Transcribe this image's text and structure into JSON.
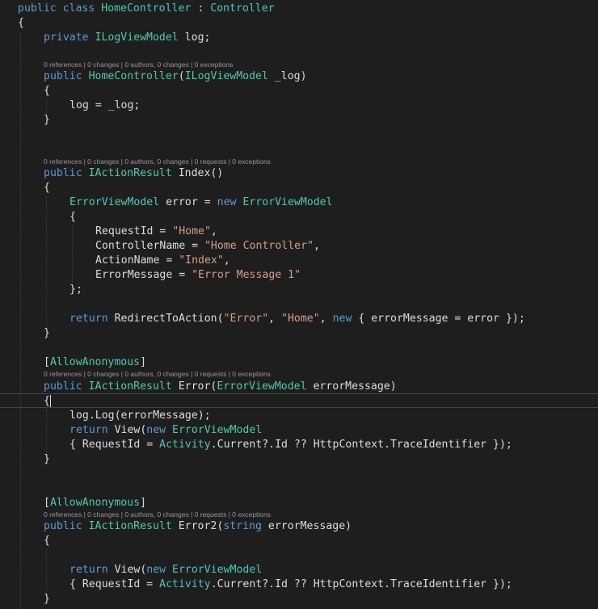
{
  "editor": {
    "codelens": {
      "constructor": "0 references | 0 changes | 0 authors, 0 changes | 0 exceptions",
      "index": "0 references | 0 changes | 0 authors, 0 changes | 0 requests | 0 exceptions",
      "error": "0 references | 0 changes | 0 authors, 0 changes | 0 requests | 0 exceptions",
      "error2": "0 references | 0 changes | 0 authors, 0 changes | 0 requests | 0 exceptions"
    },
    "lines": [
      [
        [
          "kw",
          "public "
        ],
        [
          "kw",
          "class "
        ],
        [
          "ty",
          "HomeController"
        ],
        [
          "tx",
          " : "
        ],
        [
          "ty",
          "Controller"
        ]
      ],
      [
        [
          "tx",
          "{"
        ]
      ],
      [
        [
          "kw",
          "private "
        ],
        [
          "ty",
          "ILogViewModel"
        ],
        [
          "tx",
          " log;"
        ]
      ],
      [
        [
          "kw",
          "public "
        ],
        [
          "ty",
          "HomeController"
        ],
        [
          "tx",
          "("
        ],
        [
          "ty",
          "ILogViewModel"
        ],
        [
          "tx",
          " _log)"
        ]
      ],
      [
        [
          "tx",
          "{"
        ]
      ],
      [
        [
          "tx",
          "log = _log;"
        ]
      ],
      [
        [
          "tx",
          "}"
        ]
      ],
      [
        [
          "kw",
          "public "
        ],
        [
          "ty",
          "IActionResult"
        ],
        [
          "tx",
          " Index()"
        ]
      ],
      [
        [
          "tx",
          "{"
        ]
      ],
      [
        [
          "ty",
          "ErrorViewModel"
        ],
        [
          "tx",
          " error = "
        ],
        [
          "kw",
          "new "
        ],
        [
          "ty",
          "ErrorViewModel"
        ]
      ],
      [
        [
          "tx",
          "{"
        ]
      ],
      [
        [
          "tx",
          "RequestId = "
        ],
        [
          "st",
          "\"Home\""
        ],
        [
          "tx",
          ","
        ]
      ],
      [
        [
          "tx",
          "ControllerName = "
        ],
        [
          "st",
          "\"Home Controller\""
        ],
        [
          "tx",
          ","
        ]
      ],
      [
        [
          "tx",
          "ActionName = "
        ],
        [
          "st",
          "\"Index\""
        ],
        [
          "tx",
          ","
        ]
      ],
      [
        [
          "tx",
          "ErrorMessage = "
        ],
        [
          "st",
          "\"Error Message 1\""
        ]
      ],
      [
        [
          "tx",
          "};"
        ]
      ],
      [
        [
          "kw",
          "return "
        ],
        [
          "tx",
          "RedirectToAction("
        ],
        [
          "st",
          "\"Error\""
        ],
        [
          "tx",
          ", "
        ],
        [
          "st",
          "\"Home\""
        ],
        [
          "tx",
          ", "
        ],
        [
          "kw",
          "new"
        ],
        [
          "tx",
          " { errorMessage = error });"
        ]
      ],
      [
        [
          "tx",
          "}"
        ]
      ],
      [
        [
          "tx",
          "["
        ],
        [
          "ty",
          "AllowAnonymous"
        ],
        [
          "tx",
          "]"
        ]
      ],
      [
        [
          "kw",
          "public "
        ],
        [
          "ty",
          "IActionResult"
        ],
        [
          "tx",
          " Error("
        ],
        [
          "ty",
          "ErrorViewModel"
        ],
        [
          "tx",
          " errorMessage)"
        ]
      ],
      [
        [
          "tx",
          "{"
        ]
      ],
      [
        [
          "tx",
          "log.Log(errorMessage);"
        ]
      ],
      [
        [
          "kw",
          "return "
        ],
        [
          "tx",
          "View("
        ],
        [
          "kw",
          "new "
        ],
        [
          "ty",
          "ErrorViewModel"
        ]
      ],
      [
        [
          "tx",
          "{ RequestId = "
        ],
        [
          "ty",
          "Activity"
        ],
        [
          "tx",
          ".Current?.Id ?? HttpContext.TraceIdentifier });"
        ]
      ],
      [
        [
          "tx",
          "}"
        ]
      ],
      [
        [
          "tx",
          "["
        ],
        [
          "ty",
          "AllowAnonymous"
        ],
        [
          "tx",
          "]"
        ]
      ],
      [
        [
          "kw",
          "public "
        ],
        [
          "ty",
          "IActionResult"
        ],
        [
          "tx",
          " Error2("
        ],
        [
          "kw",
          "string"
        ],
        [
          "tx",
          " errorMessage)"
        ]
      ],
      [
        [
          "tx",
          "{"
        ]
      ],
      [
        [
          "kw",
          "return "
        ],
        [
          "tx",
          "View("
        ],
        [
          "kw",
          "new "
        ],
        [
          "ty",
          "ErrorViewModel"
        ]
      ],
      [
        [
          "tx",
          "{ RequestId = "
        ],
        [
          "ty",
          "Activity"
        ],
        [
          "tx",
          ".Current?.Id ?? HttpContext.TraceIdentifier });"
        ]
      ],
      [
        [
          "tx",
          "}"
        ]
      ]
    ]
  }
}
